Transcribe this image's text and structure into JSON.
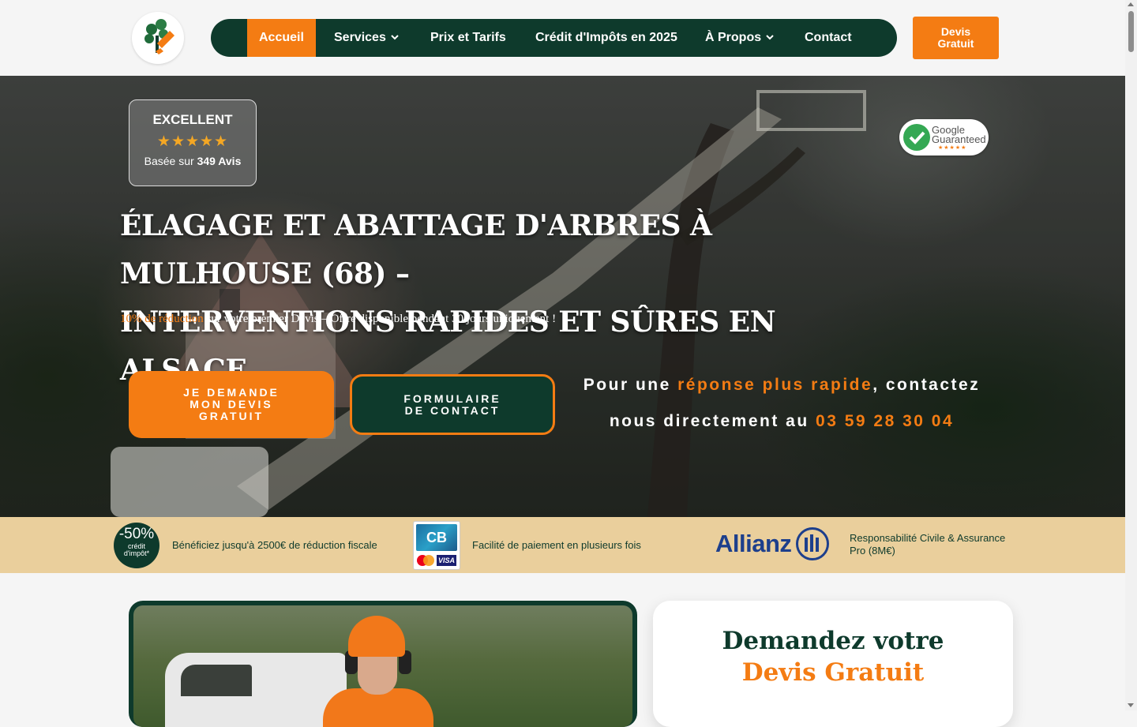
{
  "header": {
    "logo_alt": "logo élagage",
    "nav": [
      {
        "label": "Accueil",
        "active": true
      },
      {
        "label": "Services",
        "dropdown": true
      },
      {
        "label": "Prix et Tarifs"
      },
      {
        "label": "Crédit d'Impôts en 2025"
      },
      {
        "label": "À Propos",
        "dropdown": true
      },
      {
        "label": "Contact"
      }
    ],
    "cta": {
      "line1": "Devis",
      "line2": "Gratuit"
    }
  },
  "hero": {
    "review": {
      "rating_label": "EXCELLENT",
      "stars": "★★★★★",
      "based_prefix": "Basée sur ",
      "based_count": "349 Avis"
    },
    "google": {
      "line1": "Google",
      "line2": "Guaranteed",
      "stars": "★★★★★"
    },
    "title_line1": "ÉLAGAGE ET ABATTAGE D'ARBRES À MULHOUSE (68) –",
    "title_line2": "INTERVENTIONS RAPIDES ET SÛRES EN ALSACE",
    "promo_highlight": "10% de réduction",
    "promo_rest": " sur votre premier Devis – Offre disponible pendant 30 jours uniquement !",
    "btn_quote": {
      "line1": "JE DEMANDE",
      "line2": "MON DEVIS",
      "line3": "GRATUIT"
    },
    "btn_contact": {
      "line1": "FORMULAIRE",
      "line2": "DE CONTACT"
    },
    "contact_prefix": "Pour une ",
    "contact_highlight": "réponse plus rapide",
    "contact_mid": ", contactez",
    "contact_line2": "nous directement au ",
    "phone": "03 59 28 30 04"
  },
  "band": {
    "badge_percent": "-50%",
    "badge_line1": "crédit",
    "badge_line2": "d'impôt*",
    "item1": "Bénéficiez jusqu'à 2500€ de réduction fiscale",
    "cb_label": "CB",
    "visa_label": "VISA",
    "item2": "Facilité de paiement en plusieurs fois",
    "allianz_label": "Allianz",
    "item3_line1": "Responsabilité Civile & Assurance",
    "item3_line2": "Pro (8M€)"
  },
  "form": {
    "title_line1": "Demandez votre",
    "title_line2": "Devis Gratuit"
  },
  "colors": {
    "green": "#0e3a2c",
    "orange": "#f47c13",
    "sand": "#eacf9c"
  }
}
